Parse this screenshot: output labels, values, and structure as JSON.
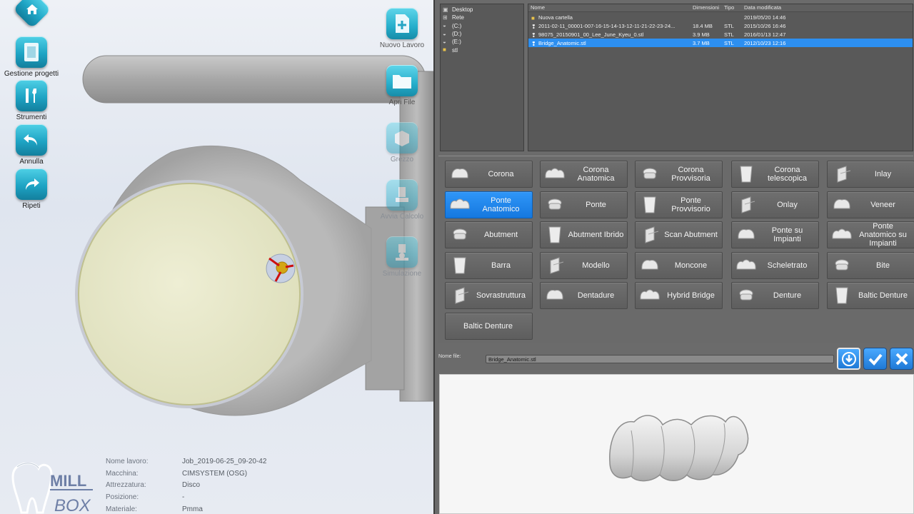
{
  "toolbar": {
    "gestione": "Gestione progetti",
    "strumenti": "Strumenti",
    "annulla": "Annulla",
    "ripeti": "Ripeti"
  },
  "vtools": {
    "nuovo_lavoro": "Nuovo Lavoro",
    "apri_file": "Apri File",
    "grezzo": "Grezzo",
    "avvia_calcolo": "Avvia Calcolo",
    "simulazione": "Simulazione"
  },
  "info": [
    {
      "key": "Nome lavoro:",
      "value": "Job_2019-06-25_09-20-42"
    },
    {
      "key": "Macchina:",
      "value": "CIMSYSTEM (OSG)"
    },
    {
      "key": "Attrezzatura:",
      "value": "Disco"
    },
    {
      "key": "Posizione:",
      "value": "-"
    },
    {
      "key": "Materiale:",
      "value": "Pmma"
    }
  ],
  "logo": {
    "line1": "MILL",
    "line2": "BOX"
  },
  "tree": [
    "Desktop",
    "Rete",
    "(C:)",
    "(D:)",
    "(E:)",
    "stl"
  ],
  "files": {
    "headers": [
      "Nome",
      "Dimensioni",
      "Tipo",
      "Data modificata"
    ],
    "rows": [
      {
        "name": "Nuova cartella",
        "size": "",
        "type": "",
        "date": "2019/05/20 14:46"
      },
      {
        "name": "2011-02-11_00001-007-16-15-14-13-12-11-21-22-23-24...",
        "size": "18.4 MB",
        "type": "STL",
        "date": "2015/10/26 16:46"
      },
      {
        "name": "98075_20150901_00_Lee_June_Kyeu_0.stl",
        "size": "3.9 MB",
        "type": "STL",
        "date": "2016/01/13 12:47"
      },
      {
        "name": "Bridge_Anatomic.stl",
        "size": "3.7 MB",
        "type": "STL",
        "date": "2012/10/23 12:16"
      }
    ]
  },
  "types": [
    [
      "Corona",
      "Corona Anatomica",
      "Corona Provvisoria",
      "Corona telescopica",
      "Inlay"
    ],
    [
      "Ponte Anatomico",
      "Ponte",
      "Ponte Provvisorio",
      "Onlay",
      "Veneer"
    ],
    [
      "Abutment",
      "Abutment Ibrido",
      "Scan Abutment",
      "Ponte su Impianti",
      "Ponte Anatomico su Impianti"
    ],
    [
      "Barra",
      "Modello",
      "Moncone",
      "Scheletrato",
      "Bite"
    ],
    [
      "Sovrastruttura",
      "Dentadure",
      "Hybrid Bridge",
      "Denture",
      "Baltic Denture"
    ],
    [
      "Baltic Denture"
    ]
  ],
  "selected_type": "Ponte Anatomico",
  "filename": {
    "label": "Nome file:",
    "value": "Bridge_Anatomic.stl"
  },
  "colors": {
    "accent": "#1f86f0",
    "panel": "#6b6b6b",
    "icon": "#26aecb"
  }
}
